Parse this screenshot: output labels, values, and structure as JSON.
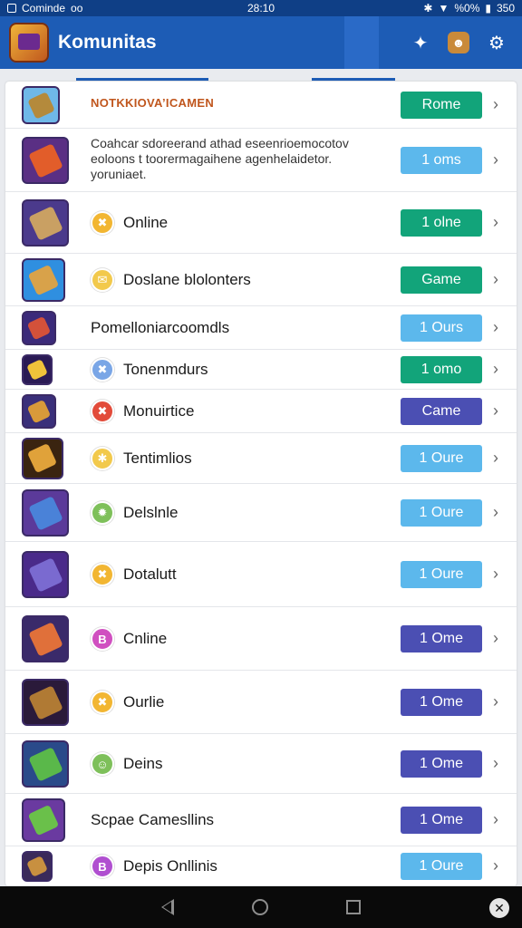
{
  "status_bar": {
    "left_text": "Cominde",
    "left_glyph": "oo",
    "time": "28:10",
    "battery": "%0%",
    "signal_text": "350"
  },
  "app_bar": {
    "title": "Komunitas",
    "actions": [
      "share-icon",
      "character-avatar-icon",
      "settings-icon"
    ]
  },
  "colors": {
    "app_bar": "#1d5cb5",
    "status_bar": "#0f3f86",
    "green": "#12a47a",
    "light_blue": "#5cb8ec",
    "indigo": "#4b4fb3"
  },
  "rows": [
    {
      "title": "NOTKKIOVA’ICAMEN",
      "button": "Rome",
      "button_color": "#12a47a",
      "bullet": "",
      "bullet_bg": "",
      "thumb_bg": "#6fb8e8",
      "thumb_fg": "#b48a3c"
    },
    {
      "title": "Coahcar sdoreerand athad eseenrioemocotov eoloons t toorermagaihene agenhelaidetor. yoruniaet.",
      "button": "1 oms",
      "button_color": "#5cb8ec",
      "bullet": "",
      "bullet_bg": "",
      "thumb_bg": "#5a2f84",
      "thumb_fg": "#e25d2a"
    },
    {
      "title": "Online",
      "button": "1 olne",
      "button_color": "#12a47a",
      "bullet": "✖",
      "bullet_bg": "#f2b632",
      "thumb_bg": "#4b3a8c",
      "thumb_fg": "#c9a063"
    },
    {
      "title": "Doslane blolonters",
      "button": "Game",
      "button_color": "#12a47a",
      "bullet": "✉",
      "bullet_bg": "#f2c94c",
      "thumb_bg": "#2f8fe0",
      "thumb_fg": "#d8a24a"
    },
    {
      "title": "Pomelloniarcoomdls",
      "button": "1 Ours",
      "button_color": "#5cb8ec",
      "bullet": "",
      "bullet_bg": "",
      "thumb_bg": "#3b2a7a",
      "thumb_fg": "#d3513a"
    },
    {
      "title": "Tonenmdurs",
      "button": "1 omo",
      "button_color": "#12a47a",
      "bullet": "✖",
      "bullet_bg": "#7aa6e6",
      "thumb_bg": "#2a1a55",
      "thumb_fg": "#f0c23a"
    },
    {
      "title": "Monuirtice",
      "button": "Came",
      "button_color": "#4b4fb3",
      "bullet": "✖",
      "bullet_bg": "#e24b3a",
      "thumb_bg": "#3a2f7a",
      "thumb_fg": "#d89a3a"
    },
    {
      "title": "Tentimlios",
      "button": "1 Oure",
      "button_color": "#5cb8ec",
      "bullet": "✱",
      "bullet_bg": "#f2c94c",
      "thumb_bg": "#3a2410",
      "thumb_fg": "#e0a23a"
    },
    {
      "title": "Delslnle",
      "button": "1 Oure",
      "button_color": "#5cb8ec",
      "bullet": "✹",
      "bullet_bg": "#7ec05a",
      "thumb_bg": "#5b3a9a",
      "thumb_fg": "#4a82d8"
    },
    {
      "title": "Dotalutt",
      "button": "1 Oure",
      "button_color": "#5cb8ec",
      "bullet": "✖",
      "bullet_bg": "#f2b632",
      "thumb_bg": "#4a2a8a",
      "thumb_fg": "#7a6ad0"
    },
    {
      "title": "Cnline",
      "button": "1 Ome",
      "button_color": "#4b4fb3",
      "bullet": "B",
      "bullet_bg": "#d04fc0",
      "thumb_bg": "#3a2a6a",
      "thumb_fg": "#e0703a"
    },
    {
      "title": "Ourlie",
      "button": "1 Ome",
      "button_color": "#4b4fb3",
      "bullet": "✖",
      "bullet_bg": "#f2b632",
      "thumb_bg": "#2a1a3a",
      "thumb_fg": "#b07a34"
    },
    {
      "title": "Deins",
      "button": "1 Ome",
      "button_color": "#4b4fb3",
      "bullet": "☺",
      "bullet_bg": "#7ec05a",
      "thumb_bg": "#2a4a8a",
      "thumb_fg": "#5ab84a"
    },
    {
      "title": "Scpae Camesllins",
      "button": "1 Ome",
      "button_color": "#4b4fb3",
      "bullet": "",
      "bullet_bg": "",
      "thumb_bg": "#6a3aa0",
      "thumb_fg": "#6ac04a"
    },
    {
      "title": "Depis Onllinis",
      "button": "1 Oure",
      "button_color": "#5cb8ec",
      "bullet": "B",
      "bullet_bg": "#b04fd0",
      "thumb_bg": "#3a2a5a",
      "thumb_fg": "#c89040"
    }
  ],
  "nav_bar": {
    "buttons": [
      "back-icon",
      "home-icon",
      "recents-icon",
      "close-icon"
    ]
  }
}
